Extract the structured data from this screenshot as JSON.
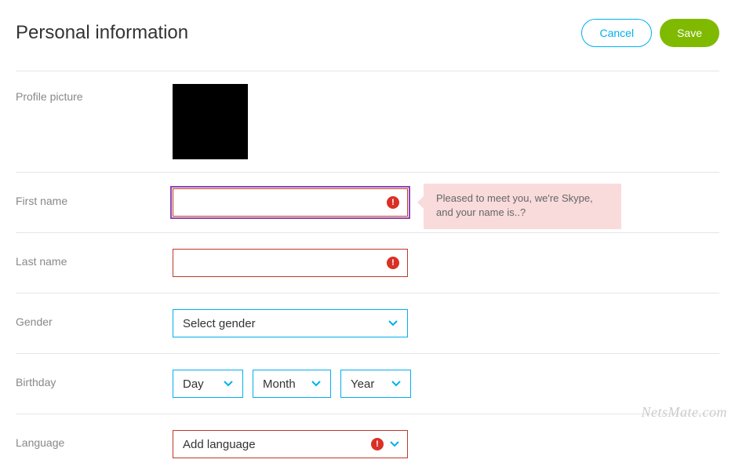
{
  "header": {
    "title": "Personal information",
    "cancel_label": "Cancel",
    "save_label": "Save"
  },
  "labels": {
    "profile_picture": "Profile picture",
    "first_name": "First name",
    "last_name": "Last name",
    "gender": "Gender",
    "birthday": "Birthday",
    "language": "Language"
  },
  "fields": {
    "first_name_value": "",
    "last_name_value": "",
    "gender_selected": "Select gender",
    "birthday_day": "Day",
    "birthday_month": "Month",
    "birthday_year": "Year",
    "language_selected": "Add language"
  },
  "tooltip": {
    "first_name": "Pleased to meet you, we're Skype, and your name is..?"
  },
  "icons": {
    "error_glyph": "!"
  },
  "colors": {
    "accent_blue": "#00aff0",
    "accent_green": "#7fba00",
    "error_red": "#d93025",
    "error_border": "#c0392b",
    "tooltip_bg": "#f9dbdb"
  },
  "watermark": "NetsMate.com"
}
